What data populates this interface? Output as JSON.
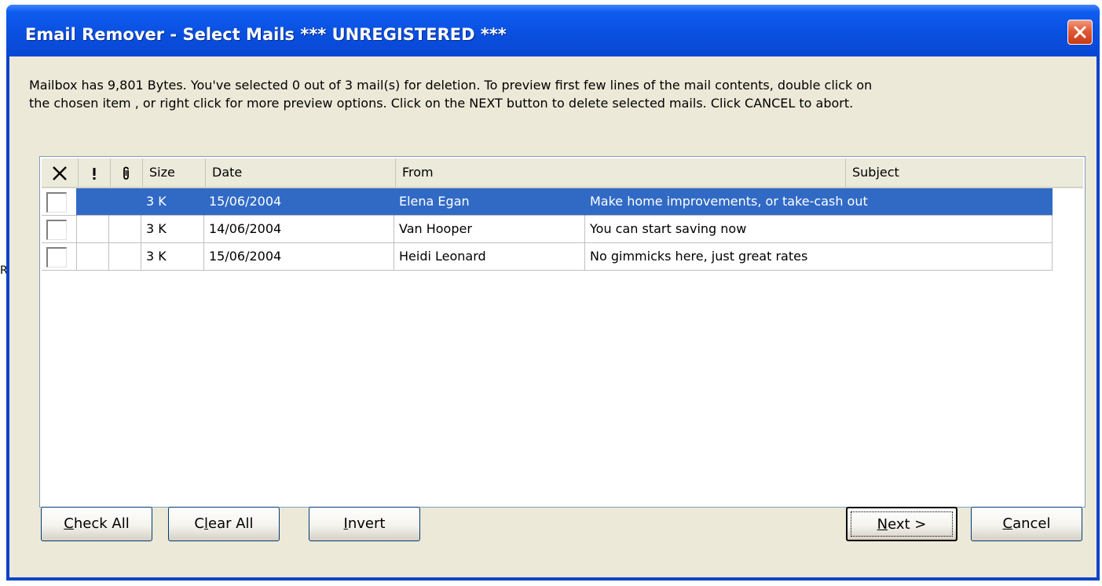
{
  "edge_char": "R",
  "window": {
    "title": "Email Remover - Select Mails *** UNREGISTERED ***"
  },
  "info": {
    "line1": "Mailbox has 9,801 Bytes.  You've selected 0 out of 3 mail(s) for deletion.  To preview first few lines of the mail contents, double click on",
    "line2": "the chosen item , or right click for more preview options. Click on the NEXT button to delete selected mails.  Click CANCEL to abort."
  },
  "list": {
    "columns": {
      "check_icon": "x-icon",
      "priority_icon": "exclamation-icon",
      "attachment_icon": "paperclip-icon",
      "size": "Size",
      "date": "Date",
      "from": "From",
      "subject": "Subject"
    },
    "rows": [
      {
        "checked": false,
        "size": "3 K",
        "date": "15/06/2004",
        "from": "Elena Egan",
        "subject": "Make home improvements, or take-cash out",
        "selected": true
      },
      {
        "checked": false,
        "size": "3 K",
        "date": "14/06/2004",
        "from": "Van Hooper",
        "subject": "You can start saving now",
        "selected": false
      },
      {
        "checked": false,
        "size": "3 K",
        "date": "15/06/2004",
        "from": "Heidi Leonard",
        "subject": "No gimmicks here, just great rates",
        "selected": false
      }
    ],
    "selection_color": "#316ac5"
  },
  "buttons": {
    "check_all": {
      "pre": "",
      "mnemonic": "C",
      "post": "heck All"
    },
    "clear_all": {
      "pre": "C",
      "mnemonic": "l",
      "post": "ear All"
    },
    "invert": {
      "pre": "",
      "mnemonic": "I",
      "post": "nvert"
    },
    "next": {
      "pre": "",
      "mnemonic": "N",
      "post": "ext >"
    },
    "cancel": {
      "pre": "",
      "mnemonic": "C",
      "post": "ancel"
    }
  },
  "colors": {
    "titlebar": "#0a50e0",
    "dialog_bg": "#ece9d8",
    "close_button": "#e05a36"
  }
}
